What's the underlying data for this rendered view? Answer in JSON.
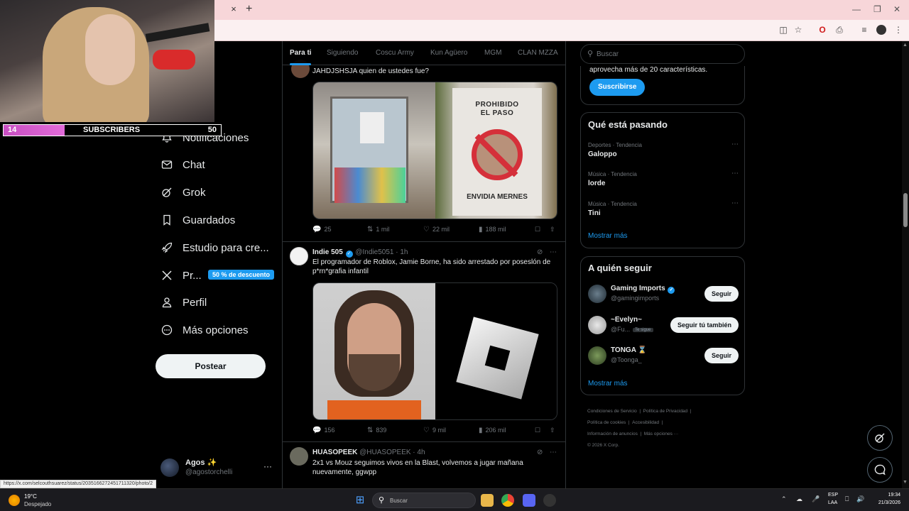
{
  "browser": {
    "close_tab": "×",
    "new_tab": "+"
  },
  "stream_overlay": {
    "subscriber_count": "14",
    "label": "SUBSCRIBERS",
    "goal": "50",
    "progress": 0.28,
    "accent": "#d45ccc"
  },
  "left_nav": {
    "items": [
      {
        "label": "Notificaciones",
        "icon": "bell-icon"
      },
      {
        "label": "Chat",
        "icon": "envelope-icon"
      },
      {
        "label": "Grok",
        "icon": "grok-icon"
      },
      {
        "label": "Guardados",
        "icon": "bookmark-icon"
      },
      {
        "label": "Estudio para cre...",
        "icon": "rocket-icon"
      },
      {
        "label": "Pr...",
        "icon": "x-logo-icon"
      },
      {
        "label": "Perfil",
        "icon": "person-icon"
      },
      {
        "label": "Más opciones",
        "icon": "more-circle-icon"
      }
    ],
    "premium_badge": "50 % de descuento",
    "post_button": "Postear",
    "account": {
      "name": "Agos ✨",
      "handle": "@agostorchelli",
      "more": "···"
    }
  },
  "timeline": {
    "tabs": [
      "Para ti",
      "Siguiendo",
      "Coscu Army",
      "Kun Agüero",
      "MGM",
      "CLAN MZZA"
    ],
    "active_tab": "Para ti",
    "tweets": [
      {
        "text": "JAHDJSHSJA quien de ustedes fue?",
        "media_sign_line1": "PROHIBIDO",
        "media_sign_line2": "EL PASO",
        "media_sign_line3": "ENVIDIA MERNES",
        "replies": "25",
        "reposts": "1 mil",
        "likes": "22 mil",
        "views": "188 mil"
      },
      {
        "name": "Indie 505",
        "handle": "@Indie5051 · 1h",
        "text": "El programador de Roblox, Jamie Borne, ha sido arrestado por poseslón de p*rn*grafia infantil",
        "replies": "156",
        "reposts": "839",
        "likes": "9 mil",
        "views": "206 mil"
      },
      {
        "name": "HUASOPEEK",
        "handle": "@HUASOPEEK · 4h",
        "text": "2x1 vs Mouz seguimos vivos en la Blast, volvemos a jugar mañana nuevamente, ggwpp"
      }
    ]
  },
  "right_sidebar": {
    "search_placeholder": "Buscar",
    "premium_text": "aprovecha más de 20 características.",
    "subscribe_button": "Suscribirse",
    "trending_title": "Qué está pasando",
    "trends": [
      {
        "category": "Deportes · Tendencia",
        "name": "Galoppo"
      },
      {
        "category": "Música · Tendencia",
        "name": "lorde"
      },
      {
        "category": "Música · Tendencia",
        "name": "Tini"
      }
    ],
    "show_more": "Mostrar más",
    "who_to_follow_title": "A quién seguir",
    "suggestions": [
      {
        "name": "Gaming Imports",
        "handle": "@gamingimports",
        "button": "Seguir"
      },
      {
        "name": "~Evelyn~",
        "handle": "@Fu...",
        "follows_you": "Te sigue",
        "button": "Seguir tú también"
      },
      {
        "name": "TONGA ⌛",
        "handle": "@Toonga_",
        "button": "Seguir"
      }
    ],
    "footer": {
      "l1a": "Condiciones de Servicio",
      "l1b": "Política de Privacidad",
      "l2a": "Política de cookies",
      "l2b": "Accesibilidad",
      "l3a": "Información de anuncios",
      "l3b": "Más opciones ···",
      "copyright": "© 2026 X Corp."
    }
  },
  "status_url": "https://x.com/selcouthsuarez/status/2035166272451711320/photo/2",
  "taskbar": {
    "temperature": "19°C",
    "weather": "Despejado",
    "search_placeholder": "Buscar",
    "lang1": "ESP",
    "lang2": "LAA",
    "time": "19:34",
    "date": "21/3/2026"
  },
  "colors": {
    "accent": "#1d9bf0",
    "background": "#000000",
    "text": "#e7e9ea",
    "muted": "#71767b"
  }
}
